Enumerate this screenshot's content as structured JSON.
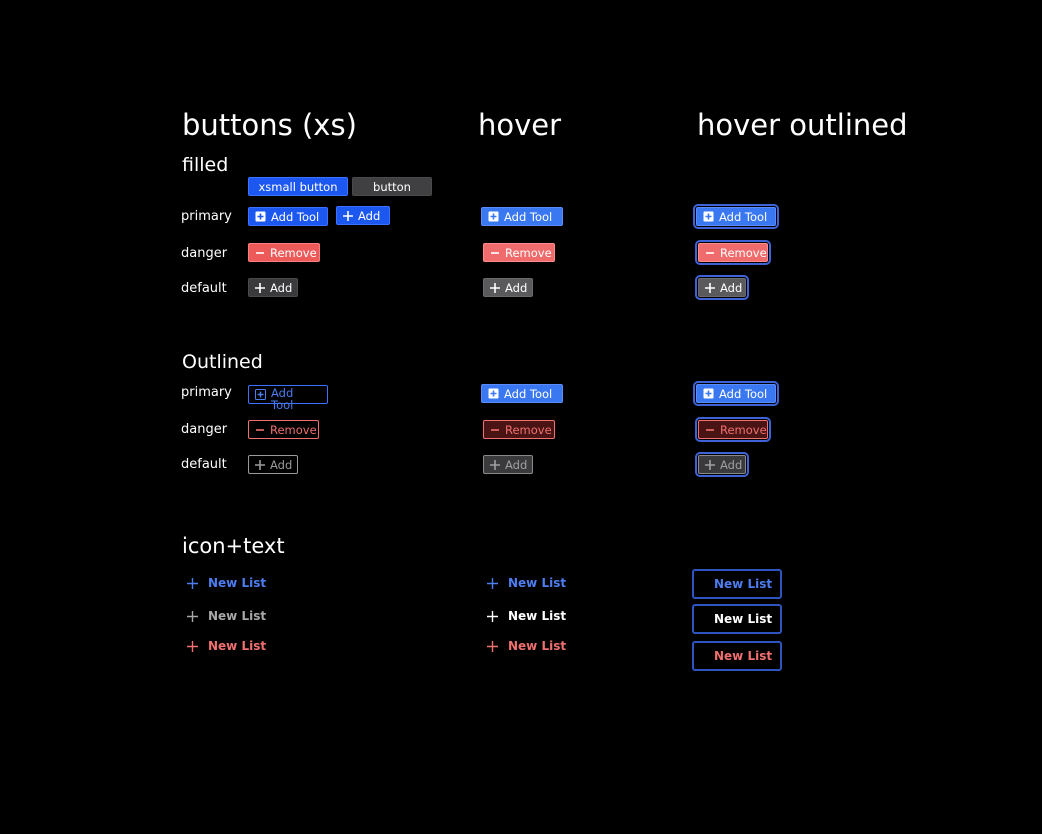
{
  "headings": {
    "col1": "buttons (xs)",
    "col2": "hover",
    "col3": "hover outlined"
  },
  "sections": {
    "filled": "filled",
    "outlined": "Outlined",
    "icon_text": "icon+text"
  },
  "row_labels": {
    "primary": "primary",
    "danger": "danger",
    "default": "default"
  },
  "sizes": {
    "xsmall": "xsmall button",
    "button": "button"
  },
  "labels": {
    "add_tool": "Add Tool",
    "add": "Add",
    "remove": "Remove",
    "new_list": "New List",
    "add_tool_wrapped_1": "Add",
    "add_tool_wrapped_2": "Tool"
  },
  "colors": {
    "primary": "#1c57f0",
    "danger": "#ec5a5a",
    "default": "#3a3a3c",
    "focus_ring": "#3f63d6"
  },
  "icons": {
    "add_tool": "plus-square-icon",
    "add": "plus-icon",
    "remove": "minus-icon"
  }
}
